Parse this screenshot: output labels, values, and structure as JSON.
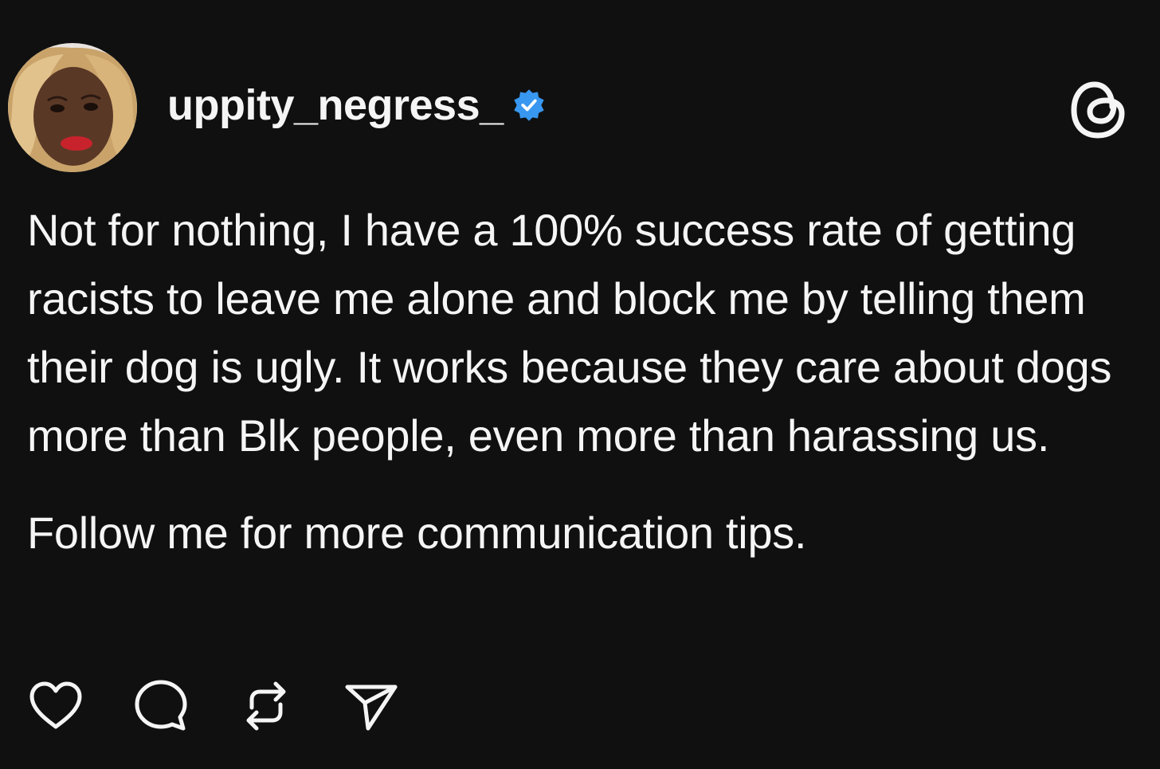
{
  "post": {
    "username": "uppity_negress_",
    "verified": true,
    "verified_color": "#3897f0",
    "app_icon": "threads-logo-icon",
    "paragraphs": [
      "Not for nothing, I have a 100% success rate of getting racists to leave me alone and block me by telling them their dog is ugly. It works because they care about dogs more than Blk people, even more than harassing us.",
      "Follow me for more communication tips."
    ],
    "actions": [
      {
        "icon": "heart-icon"
      },
      {
        "icon": "comment-icon"
      },
      {
        "icon": "repost-icon"
      },
      {
        "icon": "share-icon"
      }
    ]
  },
  "colors": {
    "background": "#101010",
    "text": "#f5f5f5"
  }
}
